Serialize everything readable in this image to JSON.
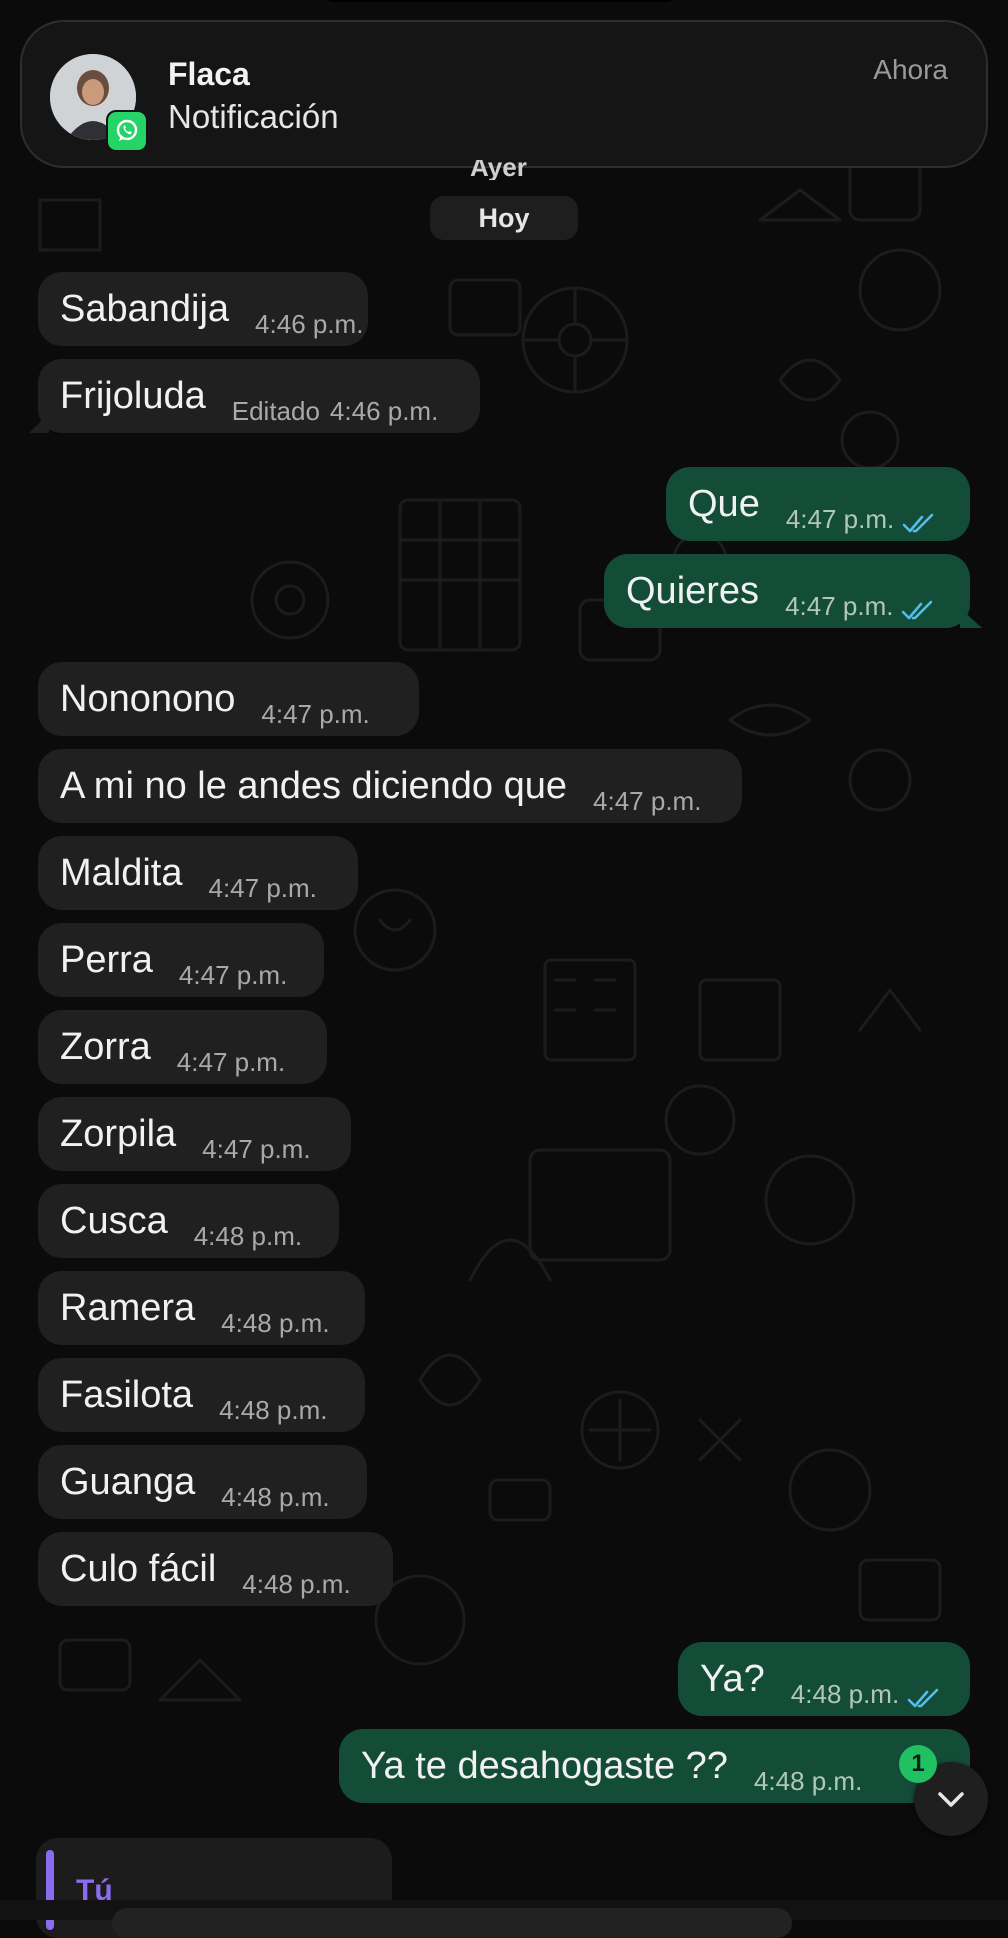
{
  "notification": {
    "title": "Flaca",
    "subtitle": "Notificación",
    "time": "Ahora"
  },
  "chat": {
    "previous_date_label": "Ayer",
    "date_label": "Hoy",
    "messages": [
      {
        "dir": "in",
        "text": "Sabandija",
        "time": "4:46 p.m."
      },
      {
        "dir": "in",
        "text": "Frijoluda",
        "edited": "Editado",
        "time": "4:46 p.m."
      },
      {
        "dir": "out",
        "text": "Que",
        "time": "4:47 p.m.",
        "status": "read"
      },
      {
        "dir": "out",
        "text": "Quieres",
        "time": "4:47 p.m.",
        "status": "read"
      },
      {
        "dir": "in",
        "text": "Nononono",
        "time": "4:47 p.m."
      },
      {
        "dir": "in",
        "text": "A mi no le andes diciendo que",
        "time": "4:47 p.m."
      },
      {
        "dir": "in",
        "text": "Maldita",
        "time": "4:47 p.m."
      },
      {
        "dir": "in",
        "text": "Perra",
        "time": "4:47 p.m."
      },
      {
        "dir": "in",
        "text": "Zorra",
        "time": "4:47 p.m."
      },
      {
        "dir": "in",
        "text": "Zorpila",
        "time": "4:47 p.m."
      },
      {
        "dir": "in",
        "text": "Cusca",
        "time": "4:48 p.m."
      },
      {
        "dir": "in",
        "text": "Ramera",
        "time": "4:48 p.m."
      },
      {
        "dir": "in",
        "text": "Fasilota",
        "time": "4:48 p.m."
      },
      {
        "dir": "in",
        "text": "Guanga",
        "time": "4:48 p.m."
      },
      {
        "dir": "in",
        "text": "Culo fácil",
        "time": "4:48 p.m."
      },
      {
        "dir": "out",
        "text": "Ya?",
        "time": "4:48 p.m.",
        "status": "read"
      },
      {
        "dir": "out",
        "text": "Ya te desahogaste ??",
        "time": "4:48 p.m.",
        "status": "read"
      }
    ],
    "unread_count": "1",
    "reply_preview_author": "Tú"
  },
  "colors": {
    "incoming_bubble": "#202020",
    "outgoing_bubble": "#144d37",
    "read_ticks": "#53bdeb",
    "whatsapp_green": "#25d366",
    "reply_accent": "#8b6cf0"
  },
  "icons": [
    "whatsapp-icon",
    "double-check-icon",
    "chevron-down-icon"
  ]
}
